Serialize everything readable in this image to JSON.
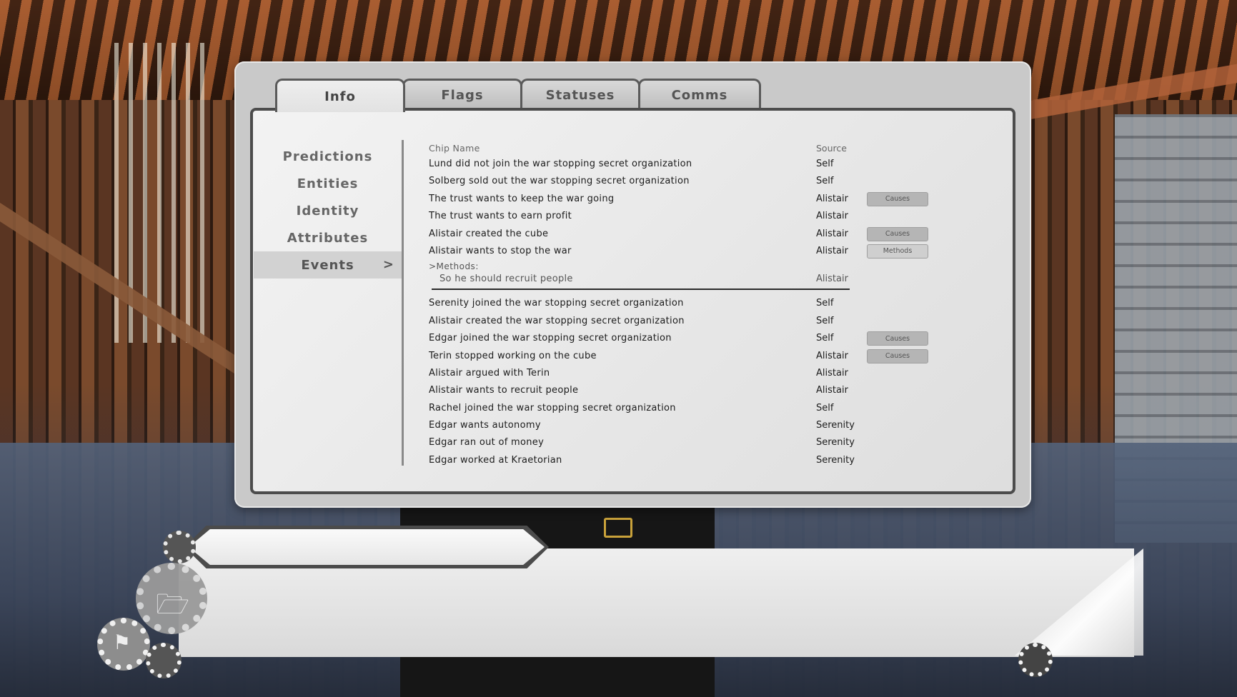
{
  "tabs": [
    {
      "label": "Info",
      "active": true
    },
    {
      "label": "Flags",
      "active": false
    },
    {
      "label": "Statuses",
      "active": false
    },
    {
      "label": "Comms",
      "active": false
    }
  ],
  "sidebar": {
    "items": [
      {
        "label": "Predictions"
      },
      {
        "label": "Entities"
      },
      {
        "label": "Identity"
      },
      {
        "label": "Attributes"
      },
      {
        "label": "Events",
        "active": true,
        "chevron": ">"
      }
    ]
  },
  "table": {
    "headers": {
      "name": "Chip Name",
      "source": "Source"
    },
    "rows": [
      {
        "name": "Lund did not join the war stopping secret organization",
        "source": "Self",
        "button": ""
      },
      {
        "name": "Solberg sold out the war stopping secret organization",
        "source": "Self",
        "button": ""
      },
      {
        "name": "The trust wants to keep the war going",
        "source": "Alistair",
        "button": "Causes"
      },
      {
        "name": "The trust wants to earn profit",
        "source": "Alistair",
        "button": ""
      },
      {
        "name": "Alistair created the cube",
        "source": "Alistair",
        "button": "Causes"
      },
      {
        "name": "Alistair wants to stop the war",
        "source": "Alistair",
        "button": "Methods"
      }
    ],
    "methods": {
      "label": ">Methods:",
      "rows": [
        {
          "name": "So he should recruit people",
          "source": "Alistair"
        }
      ]
    },
    "rows2": [
      {
        "name": "Serenity joined the war stopping secret organization",
        "source": "Self",
        "button": ""
      },
      {
        "name": "Alistair created the war stopping secret organization",
        "source": "Self",
        "button": ""
      },
      {
        "name": "Edgar joined the war stopping secret organization",
        "source": "Self",
        "button": "Causes"
      },
      {
        "name": "Terin stopped working on the cube",
        "source": "Alistair",
        "button": "Causes"
      },
      {
        "name": "Alistair argued with Terin",
        "source": "Alistair",
        "button": ""
      },
      {
        "name": "Alistair wants to recruit people",
        "source": "Alistair",
        "button": ""
      },
      {
        "name": "Rachel joined the war stopping secret organization",
        "source": "Self",
        "button": ""
      },
      {
        "name": "Edgar wants autonomy",
        "source": "Serenity",
        "button": ""
      },
      {
        "name": "Edgar ran out of money",
        "source": "Serenity",
        "button": ""
      },
      {
        "name": "Edgar worked at Kraetorian",
        "source": "Serenity",
        "button": ""
      }
    ]
  },
  "hud": {
    "name_plate": "",
    "dialog_text": "",
    "icons": [
      "folder-icon",
      "flag-icon",
      "gear-icon"
    ]
  }
}
